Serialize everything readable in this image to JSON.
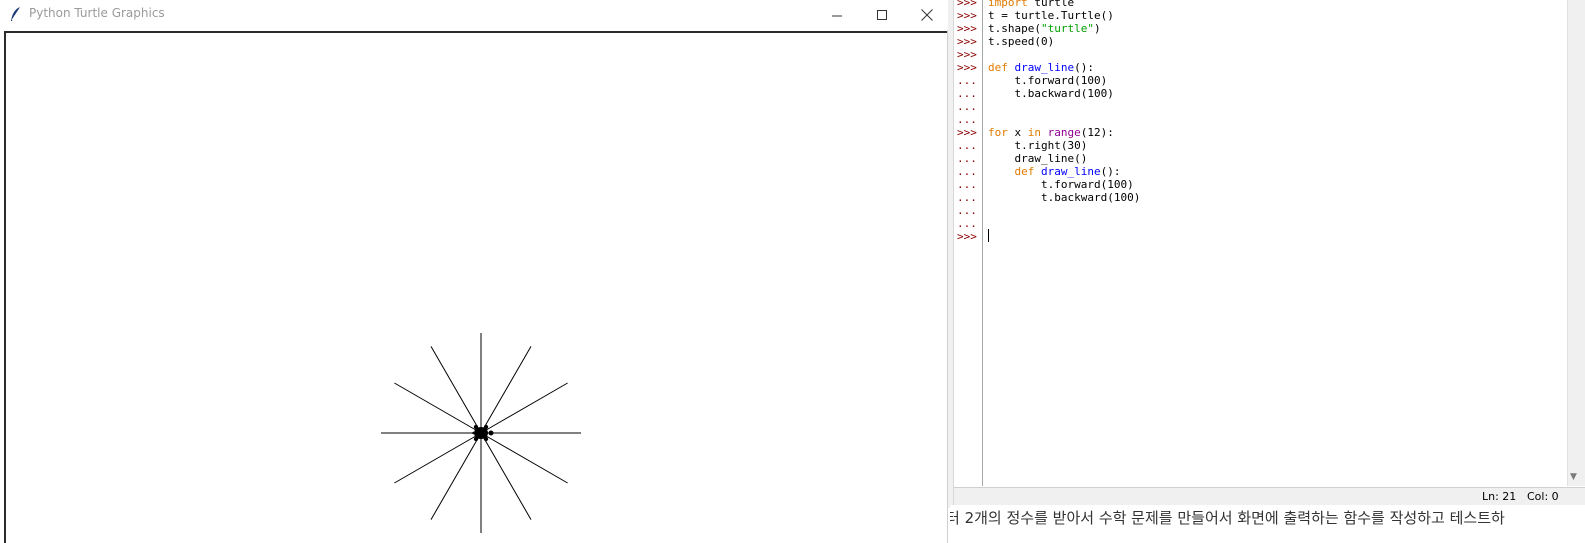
{
  "turtle_window": {
    "title": "Python Turtle Graphics",
    "controls": {
      "minimize": "minimize",
      "maximize": "maximize",
      "close": "close"
    },
    "drawing": {
      "description_free": true,
      "line_count": 12,
      "angle_step_deg": 30,
      "line_length": 100,
      "line_color": "#000000"
    }
  },
  "shell": {
    "lines": [
      {
        "prompt": ">>>",
        "code": [
          {
            "t": "import",
            "c": "kw"
          },
          {
            "t": " turtle"
          }
        ]
      },
      {
        "prompt": ">>>",
        "code": [
          {
            "t": "t = turtle.Turtle()"
          }
        ]
      },
      {
        "prompt": ">>>",
        "code": [
          {
            "t": "t.shape("
          },
          {
            "t": "\"turtle\"",
            "c": "str"
          },
          {
            "t": ")"
          }
        ]
      },
      {
        "prompt": ">>>",
        "code": [
          {
            "t": "t.speed(0)"
          }
        ]
      },
      {
        "prompt": ">>>",
        "code": []
      },
      {
        "prompt": ">>>",
        "code": [
          {
            "t": "def",
            "c": "kw"
          },
          {
            "t": " "
          },
          {
            "t": "draw_line",
            "c": "def"
          },
          {
            "t": "():"
          }
        ]
      },
      {
        "prompt": "...",
        "code": [
          {
            "t": "    t.forward(100)"
          }
        ]
      },
      {
        "prompt": "...",
        "code": [
          {
            "t": "    t.backward(100)"
          }
        ]
      },
      {
        "prompt": "...",
        "code": []
      },
      {
        "prompt": "...",
        "code": []
      },
      {
        "prompt": ">>>",
        "code": [
          {
            "t": "for",
            "c": "kw"
          },
          {
            "t": " x "
          },
          {
            "t": "in",
            "c": "kw"
          },
          {
            "t": " "
          },
          {
            "t": "range",
            "c": "bi"
          },
          {
            "t": "(12):"
          }
        ]
      },
      {
        "prompt": "...",
        "code": [
          {
            "t": "    t.right(30)"
          }
        ]
      },
      {
        "prompt": "...",
        "code": [
          {
            "t": "    draw_line()"
          }
        ]
      },
      {
        "prompt": "...",
        "code": [
          {
            "t": "    "
          },
          {
            "t": "def",
            "c": "kw"
          },
          {
            "t": " "
          },
          {
            "t": "draw_line",
            "c": "def"
          },
          {
            "t": "():"
          }
        ]
      },
      {
        "prompt": "...",
        "code": [
          {
            "t": "        t.forward(100)"
          }
        ]
      },
      {
        "prompt": "...",
        "code": [
          {
            "t": "        t.backward(100)"
          }
        ]
      },
      {
        "prompt": "...",
        "code": []
      },
      {
        "prompt": "...",
        "code": []
      },
      {
        "prompt": ">>>",
        "code": []
      }
    ],
    "status": {
      "ln": "Ln: 21",
      "col": "Col: 0"
    }
  },
  "background_text": "터 2개의 정수를 받아서 수학 문제를 만들어서 화면에 출력하는 함수를 작성하고 테스트하"
}
